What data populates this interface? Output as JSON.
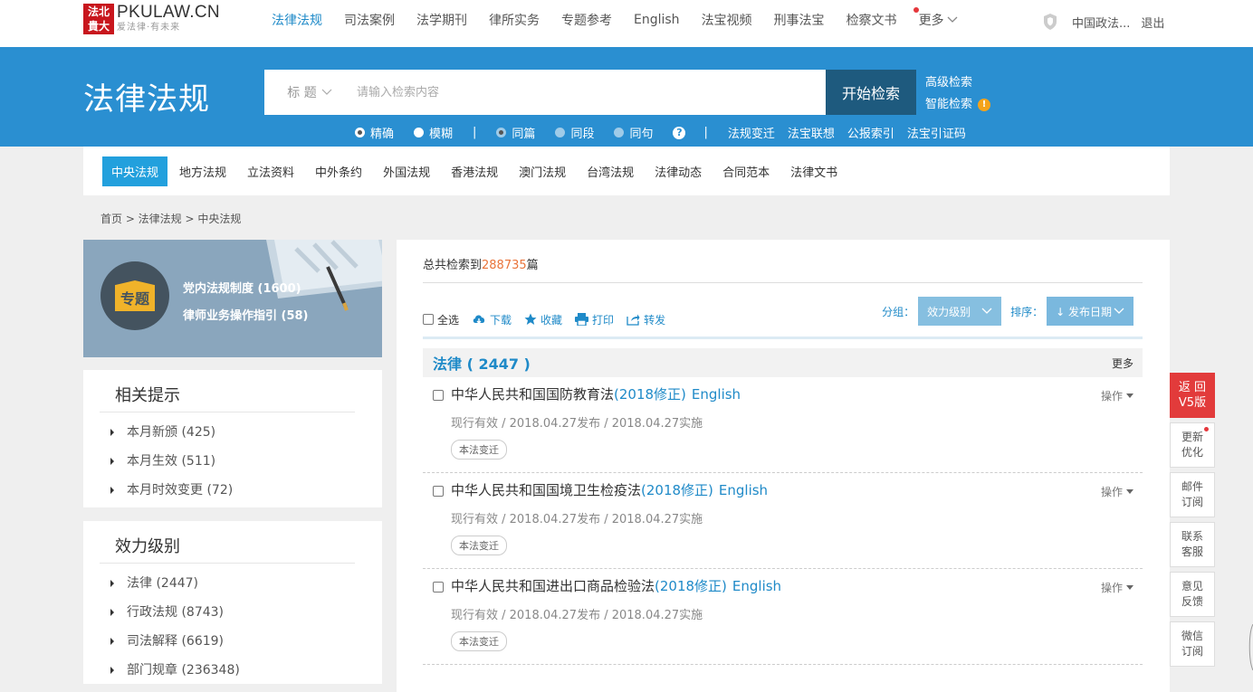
{
  "logo": {
    "badge": "法北\n貴大",
    "main": "PKULAW.CN",
    "sub": "爱法律·有未来"
  },
  "topnav": {
    "items": [
      "法律法规",
      "司法案例",
      "法学期刊",
      "律所实务",
      "专题参考",
      "English",
      "法宝视频",
      "刑事法宝",
      "检察文书",
      "更多"
    ],
    "active_index": 0
  },
  "user": {
    "name": "中国政法...",
    "logout": "退出"
  },
  "banner": {
    "title": "法律法规",
    "search_type": "标 题",
    "search_placeholder": "请输入检索内容",
    "search_button": "开始检索",
    "advanced": "高级检索",
    "smart": "智能检索",
    "warn": "!",
    "options": {
      "exact": "精确",
      "fuzzy": "模糊",
      "same_article": "同篇",
      "same_paragraph": "同段",
      "same_sentence": "同句",
      "links": [
        "法规变迁",
        "法宝联想",
        "公报索引",
        "法宝引证码"
      ]
    }
  },
  "categories": [
    "中央法规",
    "地方法规",
    "立法资料",
    "中外条约",
    "外国法规",
    "香港法规",
    "澳门法规",
    "台湾法规",
    "法律动态",
    "合同范本",
    "法律文书"
  ],
  "breadcrumb": "首页 > 法律法规 > 中央法规",
  "topic": {
    "badge": "专题",
    "links": [
      "党内法规制度 (1600)",
      "律师业务操作指引 (58)"
    ]
  },
  "related": {
    "title": "相关提示",
    "items": [
      "本月新颁 (425)",
      "本月生效 (511)",
      "本月时效变更 (72)"
    ]
  },
  "level": {
    "title": "效力级别",
    "items": [
      "法律 (2447)",
      "行政法规 (8743)",
      "司法解释 (6619)",
      "部门规章 (236348)"
    ]
  },
  "results": {
    "total_prefix": "总共检索到",
    "total": "288735",
    "total_suffix": "篇",
    "select_all": "全选",
    "tools": [
      "下载",
      "收藏",
      "打印",
      "转发"
    ],
    "group_label": "分组：",
    "group_value": "效力级别",
    "sort_label": "排序：",
    "sort_value": "↓ 发布日期",
    "group_title": "法律 ( 2447 )",
    "more": "更多",
    "items": [
      {
        "title": "中华人民共和国国防教育法",
        "rev": "(2018修正)",
        "en": "English",
        "meta": "现行有效 / 2018.04.27发布 / 2018.04.27实施",
        "tag": "本法变迁",
        "op": "操作"
      },
      {
        "title": "中华人民共和国国境卫生检疫法",
        "rev": "(2018修正)",
        "en": "English",
        "meta": "现行有效 / 2018.04.27发布 / 2018.04.27实施",
        "tag": "本法变迁",
        "op": "操作"
      },
      {
        "title": "中华人民共和国进出口商品检验法",
        "rev": "(2018修正)",
        "en": "English",
        "meta": "现行有效 / 2018.04.27发布 / 2018.04.27实施",
        "tag": "本法变迁",
        "op": "操作"
      }
    ]
  },
  "side_float": [
    "返 回\nV5版",
    "更新\n优化",
    "邮件\n订阅",
    "联系\n客服",
    "意见\n反馈",
    "微信\n订阅"
  ],
  "colors": {
    "brand_blue": "#2a8fd1",
    "link_blue": "#1f8ac8",
    "dark_btn": "#1e5a7e",
    "accent_red": "#e23b3b",
    "count_orange": "#e9743b"
  }
}
